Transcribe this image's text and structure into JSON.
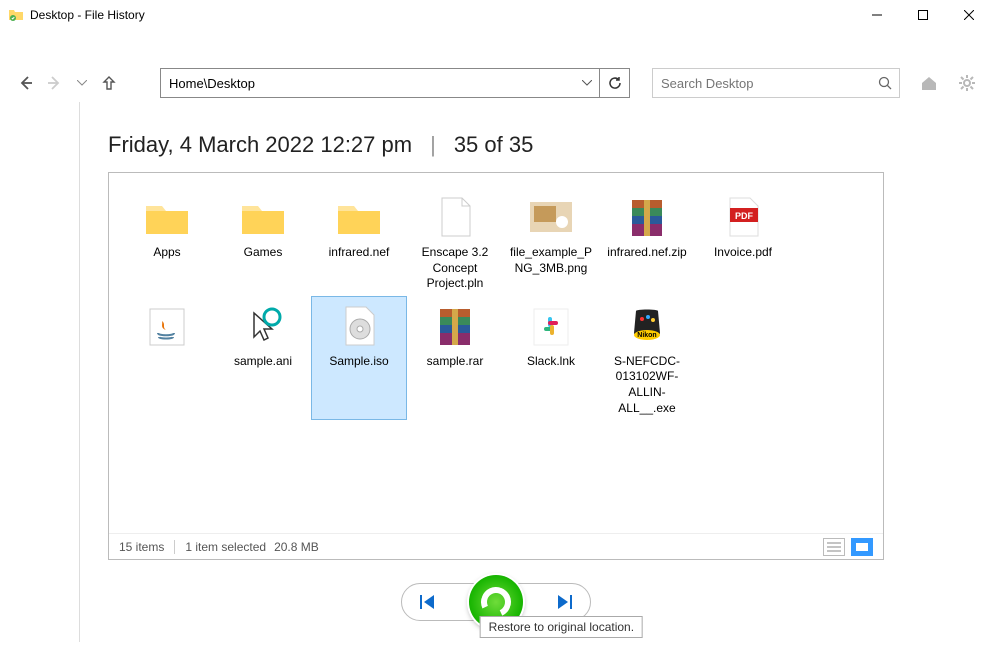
{
  "window": {
    "title": "Desktop - File History"
  },
  "nav": {
    "address": "Home\\Desktop",
    "search_placeholder": "Search Desktop"
  },
  "heading": {
    "timestamp": "Friday, 4 March 2022 12:27 pm",
    "counter": "35 of 35"
  },
  "items": [
    {
      "name": "Apps",
      "type": "folder"
    },
    {
      "name": "Games",
      "type": "folder"
    },
    {
      "name": "infrared.nef",
      "type": "folder"
    },
    {
      "name": "Enscape 3.2 Concept Project.pln",
      "type": "file"
    },
    {
      "name": "file_example_PNG_3MB.png",
      "type": "image"
    },
    {
      "name": "infrared.nef.zip",
      "type": "archive"
    },
    {
      "name": "Invoice.pdf",
      "type": "pdf"
    },
    {
      "name": "",
      "type": "java"
    },
    {
      "name": "sample.ani",
      "type": "cursor"
    },
    {
      "name": "Sample.iso",
      "type": "iso",
      "selected": true
    },
    {
      "name": "sample.rar",
      "type": "archive"
    },
    {
      "name": "Slack.lnk",
      "type": "slack"
    },
    {
      "name": "S-NEFCDC-013102WF-ALLIN-ALL__.exe",
      "type": "nikon"
    }
  ],
  "status": {
    "count": "15 items",
    "selection": "1 item selected",
    "size": "20.8 MB"
  },
  "tooltip": "Restore to original location."
}
